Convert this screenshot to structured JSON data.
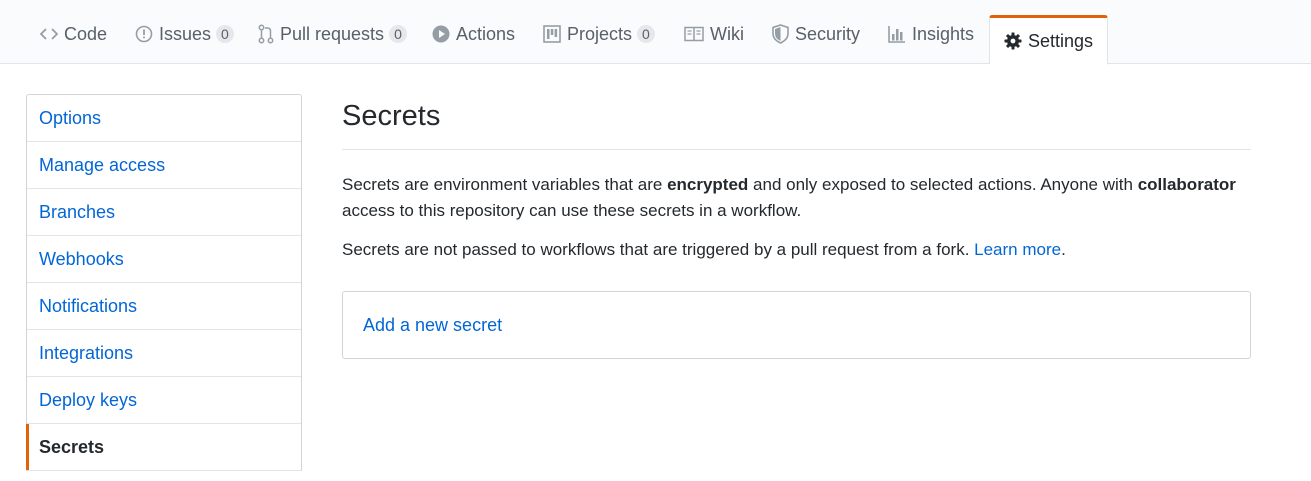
{
  "tabs": [
    {
      "id": "code",
      "label": "Code",
      "icon": "code-icon"
    },
    {
      "id": "issues",
      "label": "Issues",
      "count": "0",
      "icon": "issue-opened-icon"
    },
    {
      "id": "pulls",
      "label": "Pull requests",
      "count": "0",
      "icon": "git-pull-request-icon"
    },
    {
      "id": "actions",
      "label": "Actions",
      "icon": "play-icon"
    },
    {
      "id": "projects",
      "label": "Projects",
      "count": "0",
      "icon": "project-icon"
    },
    {
      "id": "wiki",
      "label": "Wiki",
      "icon": "book-icon"
    },
    {
      "id": "security",
      "label": "Security",
      "icon": "shield-icon"
    },
    {
      "id": "insights",
      "label": "Insights",
      "icon": "graph-icon"
    },
    {
      "id": "settings",
      "label": "Settings",
      "icon": "gear-icon",
      "selected": true
    }
  ],
  "sidebar": {
    "items": [
      {
        "label": "Options"
      },
      {
        "label": "Manage access"
      },
      {
        "label": "Branches"
      },
      {
        "label": "Webhooks"
      },
      {
        "label": "Notifications"
      },
      {
        "label": "Integrations"
      },
      {
        "label": "Deploy keys"
      },
      {
        "label": "Secrets",
        "selected": true
      }
    ]
  },
  "main": {
    "title": "Secrets",
    "intro": {
      "p1": "Secrets are environment variables that are ",
      "p1_bold1": "encrypted",
      "p1_mid": " and only exposed to selected actions. Anyone with ",
      "p1_bold2": "collaborator",
      "p1_end": " access to this repository can use these secrets in a workflow."
    },
    "fork_note": {
      "text": "Secrets are not passed to workflows that are triggered by a pull request from a fork. ",
      "link": "Learn more",
      "end": "."
    },
    "add_secret_link": "Add a new secret"
  },
  "colors": {
    "accent": "#e36209",
    "link": "#0366d6",
    "text": "#24292e",
    "muted": "#586069",
    "border": "#e1e4e8"
  }
}
